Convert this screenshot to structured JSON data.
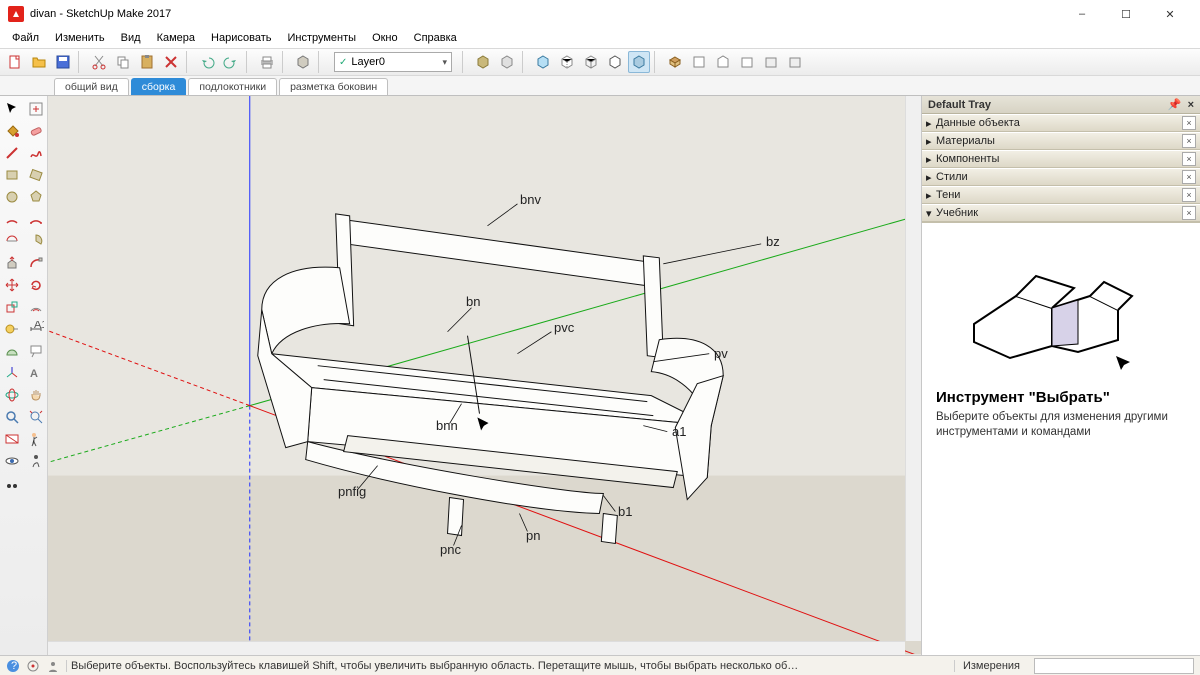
{
  "window": {
    "title": "divan - SketchUp Make 2017"
  },
  "win_controls": {
    "min": "–",
    "max": "☐",
    "close": "✕"
  },
  "menu": [
    "Файл",
    "Изменить",
    "Вид",
    "Камера",
    "Нарисовать",
    "Инструменты",
    "Окно",
    "Справка"
  ],
  "layer": {
    "name": "Layer0"
  },
  "scenes": {
    "items": [
      {
        "label": "общий вид",
        "active": false
      },
      {
        "label": "сборка",
        "active": true
      },
      {
        "label": "подлокотники",
        "active": false
      },
      {
        "label": "разметка боковин",
        "active": false
      }
    ]
  },
  "annotations": [
    "bnv",
    "bz",
    "bn",
    "pvc",
    "pv",
    "bnn",
    "a1",
    "pnfig",
    "b1",
    "pn",
    "pnc"
  ],
  "tray": {
    "title": "Default Tray",
    "panels": [
      {
        "label": "Данные объекта",
        "open": false
      },
      {
        "label": "Материалы",
        "open": false
      },
      {
        "label": "Компоненты",
        "open": false
      },
      {
        "label": "Стили",
        "open": false
      },
      {
        "label": "Тени",
        "open": false
      },
      {
        "label": "Учебник",
        "open": true
      }
    ],
    "instructor": {
      "heading": "Инструмент \"Выбрать\"",
      "body": "Выберите объекты для изменения другими инструментами и командами"
    }
  },
  "status": {
    "hint": "Выберите объекты. Воспользуйтесь клавишей Shift, чтобы увеличить выбранную область. Перетащите мышь, чтобы выбрать несколько об…",
    "measure_label": "Измерения"
  }
}
